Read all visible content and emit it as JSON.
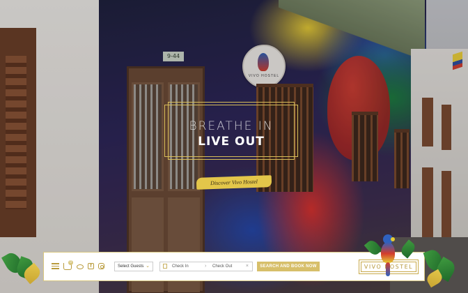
{
  "hero": {
    "line1": "BREATHE IN",
    "line2": "LIVE OUT",
    "cta": "Discover Vivo Hostel"
  },
  "scene": {
    "address_plate": "9-44",
    "sign_text": "VIVO HOSTEL"
  },
  "booking_bar": {
    "icons": [
      "menu-icon",
      "cart-icon",
      "tripadvisor-icon",
      "facebook-icon",
      "instagram-icon"
    ],
    "cart_count": "0",
    "guests_select": "Select Guests",
    "check_in": "Check  In",
    "check_out": "Check  Out",
    "clear_symbol": "×",
    "arrow_symbol": "›",
    "facebook_glyph": "f",
    "dropdown_glyph": "⌄",
    "search_button": "SEARCH AND BOOK NOW",
    "logo": "VIVO HOSTEL"
  },
  "colors": {
    "accent_gold": "#d7bf6a",
    "bar_bg": "#ffffff",
    "foliage": "#2f7f34"
  }
}
